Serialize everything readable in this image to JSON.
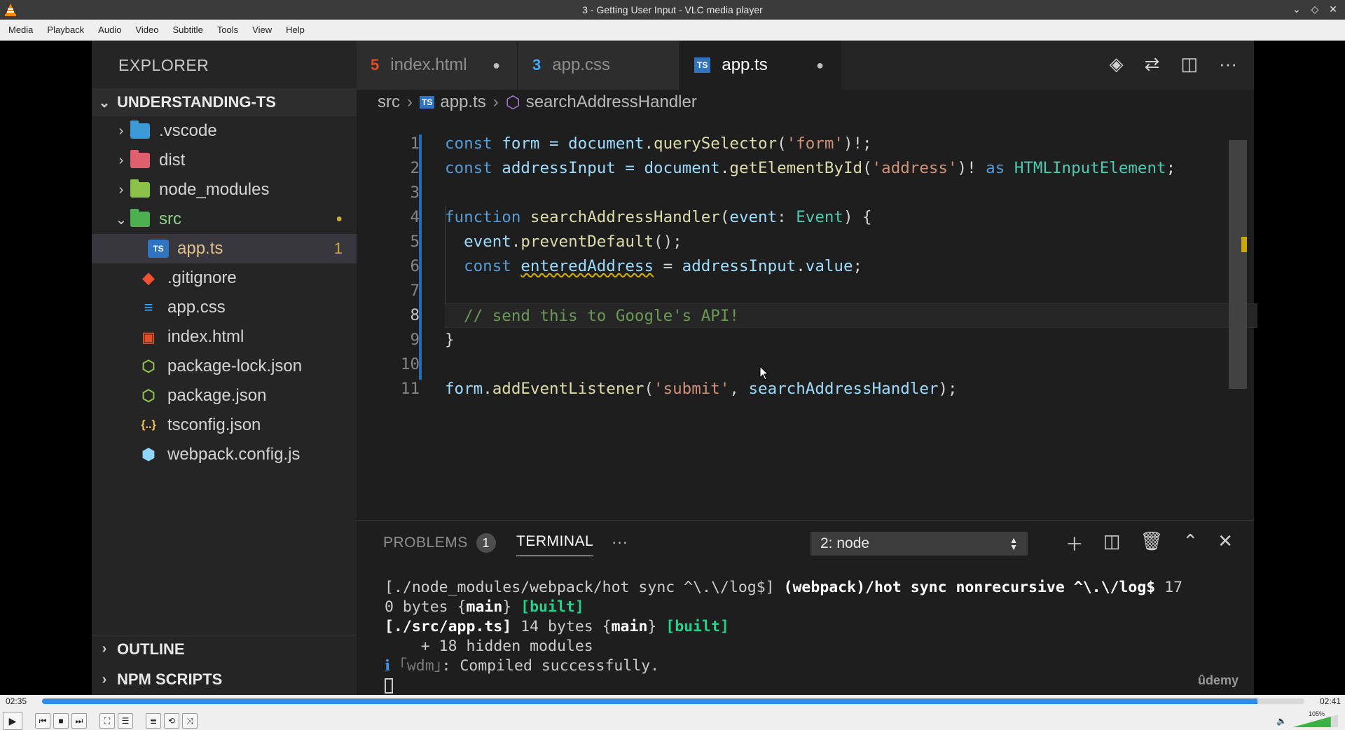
{
  "window": {
    "title": "3 - Getting User Input - VLC media player"
  },
  "menubar": [
    "Media",
    "Playback",
    "Audio",
    "Video",
    "Subtitle",
    "Tools",
    "View",
    "Help"
  ],
  "explorer": {
    "header": "EXPLORER",
    "project": "UNDERSTANDING-TS",
    "items": [
      {
        "name": ".vscode",
        "icon": "vscode-folder-icon",
        "color": "#3c9bd6"
      },
      {
        "name": "dist",
        "icon": "dist-folder-icon",
        "color": "#e05f6f"
      },
      {
        "name": "node_modules",
        "icon": "node-folder-icon",
        "color": "#8bc34a"
      },
      {
        "name": "src",
        "icon": "src-folder-icon",
        "color": "#4caf50",
        "badge": "●"
      },
      {
        "name": "app.ts",
        "icon": "typescript-file-icon",
        "color": "#2f74c0",
        "badge": "1"
      },
      {
        "name": ".gitignore",
        "icon": "git-file-icon",
        "color": "#f05033"
      },
      {
        "name": "app.css",
        "icon": "css-file-icon",
        "color": "#42a5f5"
      },
      {
        "name": "index.html",
        "icon": "html-file-icon",
        "color": "#e44d26"
      },
      {
        "name": "package-lock.json",
        "icon": "npm-file-icon",
        "color": "#8bc34a"
      },
      {
        "name": "package.json",
        "icon": "npm-file-icon",
        "color": "#8bc34a"
      },
      {
        "name": "tsconfig.json",
        "icon": "json-file-icon",
        "color": "#f9c74f"
      },
      {
        "name": "webpack.config.js",
        "icon": "webpack-file-icon",
        "color": "#8ed6fb"
      }
    ],
    "outline": "OUTLINE",
    "npm_scripts": "NPM SCRIPTS"
  },
  "tabs": [
    {
      "label": "index.html",
      "icon": "html-file-icon",
      "glyph": "5",
      "color": "#e44d26",
      "dirty": "●"
    },
    {
      "label": "app.css",
      "icon": "css-file-icon",
      "glyph": "3",
      "color": "#42a5f5",
      "dirty": ""
    },
    {
      "label": "app.ts",
      "icon": "typescript-file-icon",
      "glyph": "TS",
      "color": "#2f74c0",
      "dirty": "●"
    }
  ],
  "breadcrumb": {
    "folder": "src",
    "file": "app.ts",
    "symbol": "searchAddressHandler"
  },
  "editor": {
    "line_numbers": [
      "1",
      "2",
      "3",
      "4",
      "5",
      "6",
      "7",
      "8",
      "9",
      "10",
      "11"
    ],
    "current_line": 8,
    "lines": {
      "l1": {
        "a": "const",
        "b": " form = ",
        "c": "document",
        "d": ".",
        "e": "querySelector",
        "f": "(",
        "g": "'form'",
        "h": ")!;"
      },
      "l2": {
        "a": "const",
        "b": " addressInput = ",
        "c": "document",
        "d": ".",
        "e": "getElementById",
        "f": "(",
        "g": "'address'",
        "h": ")! ",
        "i": "as",
        "j": " ",
        "k": "HTMLInputElement",
        "l": ";"
      },
      "l4": {
        "a": "function",
        "b": " ",
        "c": "searchAddressHandler",
        "d": "(",
        "e": "event",
        "f": ": ",
        "g": "Event",
        "h": ") {"
      },
      "l5": {
        "a": "  ",
        "b": "event",
        "c": ".",
        "d": "preventDefault",
        "e": "();"
      },
      "l6": {
        "a": "  ",
        "b": "const",
        "c": " ",
        "d": "enteredAddress",
        "e": " = ",
        "f": "addressInput",
        "g": ".",
        "h": "value",
        "i": ";"
      },
      "l8": {
        "a": "  ",
        "b": "// send this to Google's API!"
      },
      "l9": {
        "a": "}"
      },
      "l11": {
        "a": "form",
        "b": ".",
        "c": "addEventListener",
        "d": "(",
        "e": "'submit'",
        "f": ", ",
        "g": "searchAddressHandler",
        "h": ");"
      }
    }
  },
  "panel": {
    "problems_label": "PROBLEMS",
    "problems_count": "1",
    "terminal_label": "TERMINAL",
    "more": "···",
    "terminal_select": "2: node",
    "terminal_lines": {
      "t1a": "[./node_modules/webpack/hot sync ^\\.\\/log$] ",
      "t1b": "(webpack)/hot sync nonrecursive ^\\.\\/log$",
      "t1c": " 17",
      "t2a": "0 bytes {",
      "t2b": "main",
      "t2c": "} ",
      "t2d": "[built]",
      "t3a": "[./src/app.ts]",
      "t3b": " 14 bytes {",
      "t3c": "main",
      "t3d": "} ",
      "t3e": "[built]",
      "t4": "    + 18 hidden modules",
      "t5a": "ℹ",
      "t5b": " ｢wdm｣",
      "t5c": ": Compiled successfully."
    }
  },
  "watermark": "ûdemy",
  "player": {
    "elapsed": "02:35",
    "total": "02:41",
    "progress": 0.9627,
    "volume_label": "105%",
    "volume": 1.05,
    "accent": "#2f8be6"
  }
}
